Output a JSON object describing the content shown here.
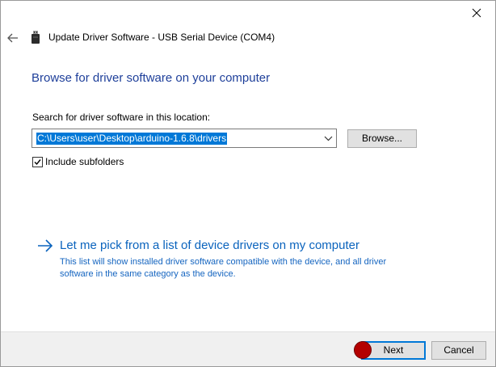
{
  "window": {
    "title": "Update Driver Software - USB Serial Device (COM4)"
  },
  "heading": "Browse for driver software on your computer",
  "search": {
    "label": "Search for driver software in this location:",
    "path_value": "C:\\Users\\user\\Desktop\\arduino-1.6.8\\drivers",
    "browse_label": "Browse..."
  },
  "subfolders": {
    "label": "Include subfolders",
    "checked": true
  },
  "pick": {
    "title": "Let me pick from a list of device drivers on my computer",
    "desc_line1": "This list will show installed driver software compatible with the device, and all driver",
    "desc_line2": "software in the same category as the device."
  },
  "footer": {
    "next_label": "Next",
    "cancel_label": "Cancel"
  },
  "icons": {
    "close": "close-icon",
    "back": "back-arrow-icon",
    "device": "usb-device-icon",
    "dropdown": "chevron-down-icon",
    "pick_arrow": "right-arrow-icon",
    "check": "checkmark-icon"
  },
  "colors": {
    "heading": "#1e3f9a",
    "link": "#0a63bd",
    "selection": "#0078d7",
    "footer_bg": "#f0f0f0",
    "cursor_marker": "#b40000"
  }
}
